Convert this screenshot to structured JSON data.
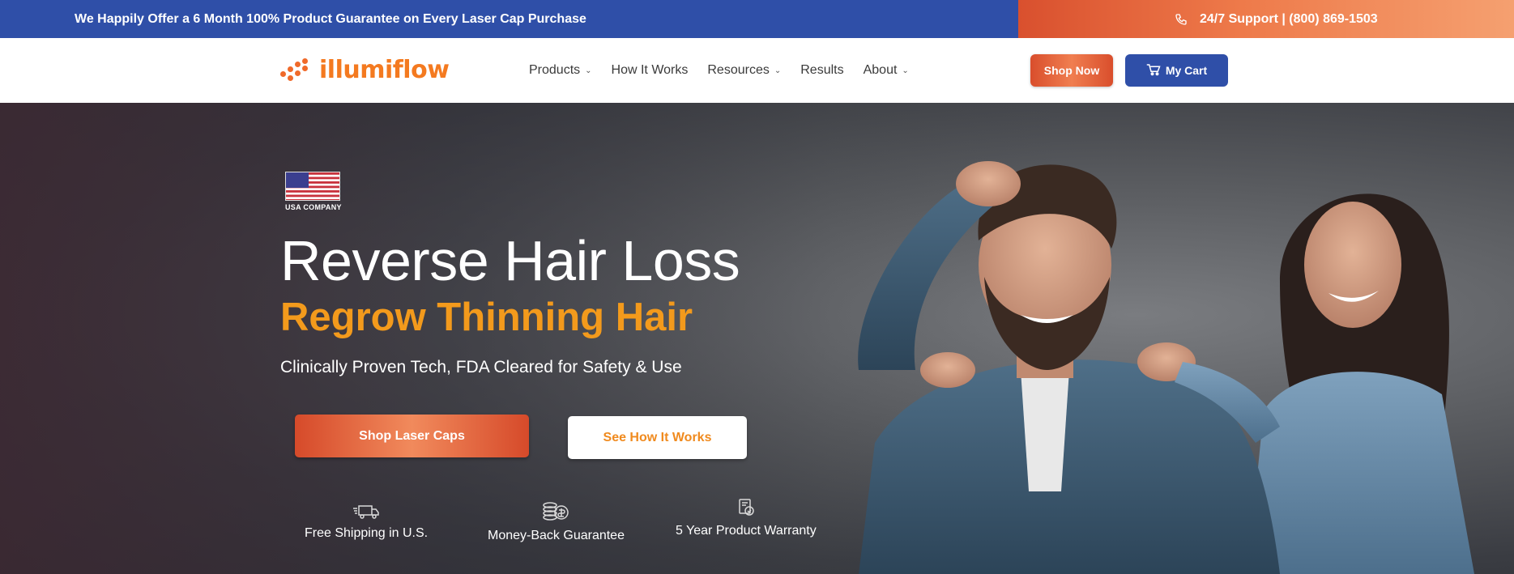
{
  "topbar": {
    "guarantee_text": "We Happily Offer a 6 Month 100% Product Guarantee on Every Laser Cap Purchase",
    "support_text": "24/7 Support | (800) 869-1503",
    "phone_icon": "phone-icon"
  },
  "header": {
    "logo_text": "illumiflow",
    "nav": [
      {
        "label": "Products",
        "has_dropdown": true
      },
      {
        "label": "How It Works",
        "has_dropdown": false
      },
      {
        "label": "Resources",
        "has_dropdown": true
      },
      {
        "label": "Results",
        "has_dropdown": false
      },
      {
        "label": "About",
        "has_dropdown": true
      }
    ],
    "shop_now_label": "Shop Now",
    "cart_label": "My Cart",
    "cart_icon": "cart-icon"
  },
  "hero": {
    "badge_label": "USA COMPANY",
    "headline": "Reverse Hair Loss",
    "subheadline": "Regrow Thinning Hair",
    "tagline": "Clinically Proven Tech, FDA Cleared for Safety & Use",
    "primary_cta": "Shop Laser Caps",
    "secondary_cta": "See How It Works",
    "features": [
      {
        "icon": "truck-icon",
        "label": "Free Shipping in U.S."
      },
      {
        "icon": "coins-icon",
        "label": "Money-Back Guarantee"
      },
      {
        "icon": "warranty-icon",
        "label": "5 Year Product Warranty"
      }
    ]
  },
  "colors": {
    "brand_blue": "#2f4fa8",
    "brand_orange": "#f06a2a",
    "accent_amber": "#f39a1c"
  }
}
